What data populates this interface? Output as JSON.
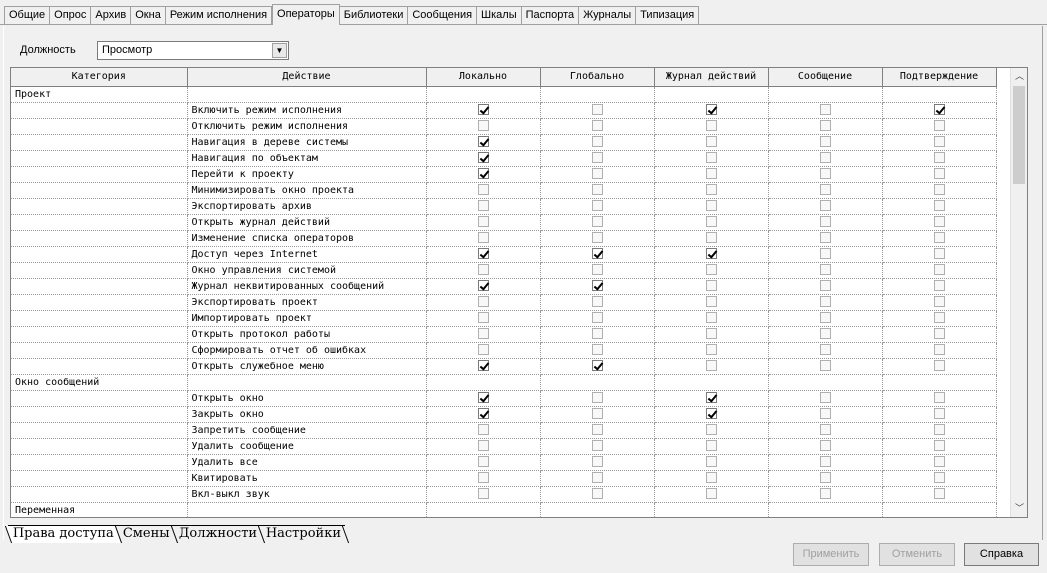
{
  "top_tabs": [
    "Общие",
    "Опрос",
    "Архив",
    "Окна",
    "Режим исполнения",
    "Операторы",
    "Библиотеки",
    "Сообщения",
    "Шкалы",
    "Паспорта",
    "Журналы",
    "Типизация"
  ],
  "active_top_tab": "Операторы",
  "role": {
    "label": "Должность",
    "value": "Просмотр"
  },
  "columns": [
    "Категория",
    "Действие",
    "Локально",
    "Глобально",
    "Журнал действий",
    "Сообщение",
    "Подтверждение"
  ],
  "rows": [
    {
      "category": "Проект",
      "action": "",
      "checks": null
    },
    {
      "category": "",
      "action": "Включить режим исполнения",
      "checks": [
        true,
        false,
        true,
        false,
        true
      ]
    },
    {
      "category": "",
      "action": "Отключить режим исполнения",
      "checks": [
        false,
        false,
        false,
        false,
        false
      ]
    },
    {
      "category": "",
      "action": "Навигация в дереве системы",
      "checks": [
        true,
        false,
        false,
        false,
        false
      ]
    },
    {
      "category": "",
      "action": "Навигация по объектам",
      "checks": [
        true,
        false,
        false,
        false,
        false
      ]
    },
    {
      "category": "",
      "action": "Перейти к проекту",
      "checks": [
        true,
        false,
        false,
        false,
        false
      ]
    },
    {
      "category": "",
      "action": "Минимизировать окно проекта",
      "checks": [
        false,
        false,
        false,
        false,
        false
      ]
    },
    {
      "category": "",
      "action": "Экспортировать архив",
      "checks": [
        false,
        false,
        false,
        false,
        false
      ]
    },
    {
      "category": "",
      "action": "Открыть журнал действий",
      "checks": [
        false,
        false,
        false,
        false,
        false
      ]
    },
    {
      "category": "",
      "action": "Изменение списка операторов",
      "checks": [
        false,
        false,
        false,
        false,
        false
      ]
    },
    {
      "category": "",
      "action": "Доступ через Internet",
      "checks": [
        true,
        true,
        true,
        false,
        false
      ]
    },
    {
      "category": "",
      "action": "Окно управления системой",
      "checks": [
        false,
        false,
        false,
        false,
        false
      ]
    },
    {
      "category": "",
      "action": "Журнал неквитированных сообщений",
      "checks": [
        true,
        true,
        false,
        false,
        false
      ]
    },
    {
      "category": "",
      "action": "Экспортировать проект",
      "checks": [
        false,
        false,
        false,
        false,
        false
      ]
    },
    {
      "category": "",
      "action": "Импортировать проект",
      "checks": [
        false,
        false,
        false,
        false,
        false
      ]
    },
    {
      "category": "",
      "action": "Открыть протокол работы",
      "checks": [
        false,
        false,
        false,
        false,
        false
      ]
    },
    {
      "category": "",
      "action": "Сформировать отчет об ошибках",
      "checks": [
        false,
        false,
        false,
        false,
        false
      ]
    },
    {
      "category": "",
      "action": "Открыть служебное меню",
      "checks": [
        true,
        true,
        false,
        false,
        false
      ]
    },
    {
      "category": "Окно сообщений",
      "action": "",
      "checks": null
    },
    {
      "category": "",
      "action": "Открыть окно",
      "checks": [
        true,
        false,
        true,
        false,
        false
      ]
    },
    {
      "category": "",
      "action": "Закрыть окно",
      "checks": [
        true,
        false,
        true,
        false,
        false
      ]
    },
    {
      "category": "",
      "action": "Запретить сообщение",
      "checks": [
        false,
        false,
        false,
        false,
        false
      ]
    },
    {
      "category": "",
      "action": "Удалить сообщение",
      "checks": [
        false,
        false,
        false,
        false,
        false
      ]
    },
    {
      "category": "",
      "action": "Удалить все",
      "checks": [
        false,
        false,
        false,
        false,
        false
      ]
    },
    {
      "category": "",
      "action": "Квитировать",
      "checks": [
        false,
        false,
        false,
        false,
        false
      ]
    },
    {
      "category": "",
      "action": "Вкл-выкл звук",
      "checks": [
        false,
        false,
        false,
        false,
        false
      ]
    },
    {
      "category": "Переменная",
      "action": "",
      "checks": null
    }
  ],
  "bottom_tabs": [
    "Права доступа",
    "Смены",
    "Должности",
    "Настройки"
  ],
  "active_bottom_tab": "Права доступа",
  "buttons": {
    "apply": "Применить",
    "cancel": "Отменить",
    "help": "Справка"
  },
  "icons": {
    "dropdown": "chevron-down-icon",
    "scroll_up": "arrow-up-icon",
    "scroll_down": "arrow-down-icon"
  }
}
